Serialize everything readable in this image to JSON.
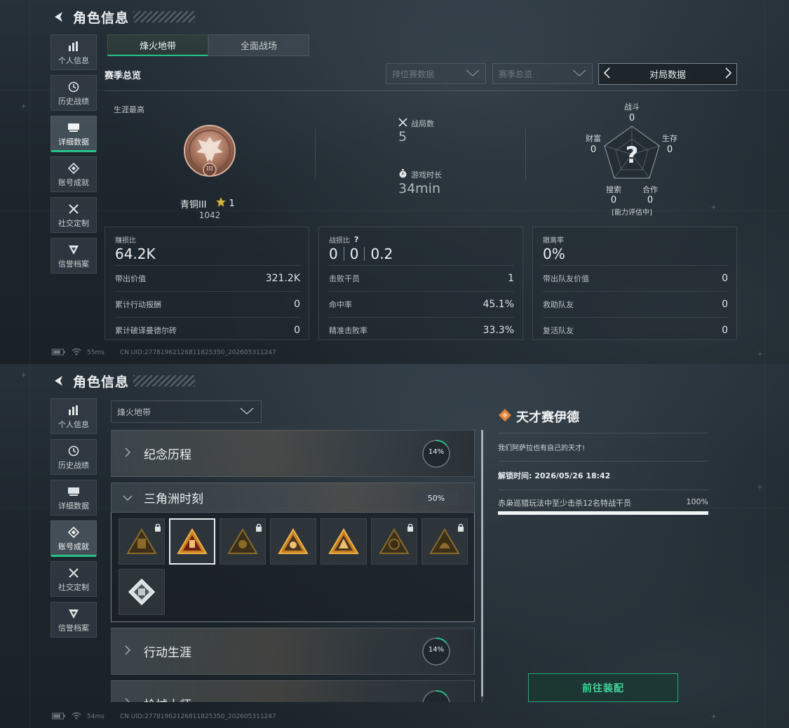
{
  "header": {
    "title": "角色信息"
  },
  "sidebar": {
    "items": [
      {
        "label": "个人信息",
        "icon": "bar-chart-icon"
      },
      {
        "label": "历史战绩",
        "icon": "history-icon"
      },
      {
        "label": "详细数据",
        "icon": "folder-icon"
      },
      {
        "label": "账号成就",
        "icon": "achievement-icon"
      },
      {
        "label": "社交定制",
        "icon": "tools-icon"
      },
      {
        "label": "信誉档案",
        "icon": "shield-icon"
      }
    ]
  },
  "screen1": {
    "active_sidebar": "详细数据",
    "tabs": [
      {
        "label": "烽火地带",
        "active": true
      },
      {
        "label": "全面战场",
        "active": false
      }
    ],
    "section_title": "赛季总览",
    "filters": {
      "ranked_placeholder": "排位赛数据",
      "season_placeholder": "赛季总览",
      "nav_label": "对局数据"
    },
    "career": {
      "label": "生涯最高",
      "rank_name": "青铜III",
      "stars": "1",
      "score": "1042",
      "rank_numeral": "III"
    },
    "matches": {
      "label": "战局数",
      "value": "5"
    },
    "playtime": {
      "label": "游戏时长",
      "value": "34min"
    },
    "radar": {
      "center": "?",
      "axes": [
        {
          "label": "战斗",
          "value": "0"
        },
        {
          "label": "生存",
          "value": "0"
        },
        {
          "label": "合作",
          "value": "0"
        },
        {
          "label": "搜索",
          "value": "0"
        },
        {
          "label": "财富",
          "value": "0"
        }
      ],
      "status": "[能力评估中]"
    },
    "cards": [
      {
        "head_label": "赚损比",
        "head_value": "64.2K",
        "rows": [
          {
            "label": "带出价值",
            "value": "321.2K"
          },
          {
            "label": "累计行动报酬",
            "value": "0"
          },
          {
            "label": "累计破译曼德尔砖",
            "value": "0"
          }
        ]
      },
      {
        "head_label": "战损比",
        "help": "?",
        "head_values": [
          "0",
          "0",
          "0.2"
        ],
        "rows": [
          {
            "label": "击败干员",
            "value": "1"
          },
          {
            "label": "命中率",
            "value": "45.1%"
          },
          {
            "label": "精准击败率",
            "value": "33.3%"
          }
        ]
      },
      {
        "head_label": "撤离率",
        "head_value": "0%",
        "rows": [
          {
            "label": "带出队友价值",
            "value": "0"
          },
          {
            "label": "救助队友",
            "value": "0"
          },
          {
            "label": "复活队友",
            "value": "0"
          }
        ]
      }
    ],
    "footer": {
      "ping": "55ms",
      "uid": "CN UID:27781962126811825350_202605311247"
    }
  },
  "screen2": {
    "active_sidebar": "账号成就",
    "zone_select": "烽火地带",
    "categories": [
      {
        "name": "纪念历程",
        "percent": "14%",
        "progress": 0.14,
        "open": false
      },
      {
        "name": "三角洲时刻",
        "percent": "50%",
        "progress": 0.5,
        "open": true
      },
      {
        "name": "行动生涯",
        "percent": "14%",
        "progress": 0.14,
        "open": false
      },
      {
        "name": "枪械大师",
        "percent": "",
        "progress": 0.14,
        "open": false
      }
    ],
    "badges": [
      {
        "locked": true,
        "selected": false
      },
      {
        "locked": false,
        "selected": true
      },
      {
        "locked": true,
        "selected": false
      },
      {
        "locked": false,
        "selected": false
      },
      {
        "locked": false,
        "selected": false
      },
      {
        "locked": true,
        "selected": false
      },
      {
        "locked": true,
        "selected": false
      },
      {
        "locked": false,
        "selected": false
      }
    ],
    "detail": {
      "title": "天才赛伊德",
      "description": "我们阿萨拉也有自己的天才!",
      "unlock_time": "解锁时间: 2026/05/26 18:42",
      "task": "赤枭巡猎玩法中至少击杀12名特战干员",
      "task_percent": "100%",
      "task_progress": 1.0
    },
    "equip_button": "前往装配",
    "footer": {
      "ping": "54ms",
      "uid": "CN UID:27781962126811825350_202605311247"
    }
  },
  "colors": {
    "accent": "#27c28a",
    "equip_text": "#3fd69a",
    "gold": "#d9a63a",
    "orange": "#e0823a"
  }
}
